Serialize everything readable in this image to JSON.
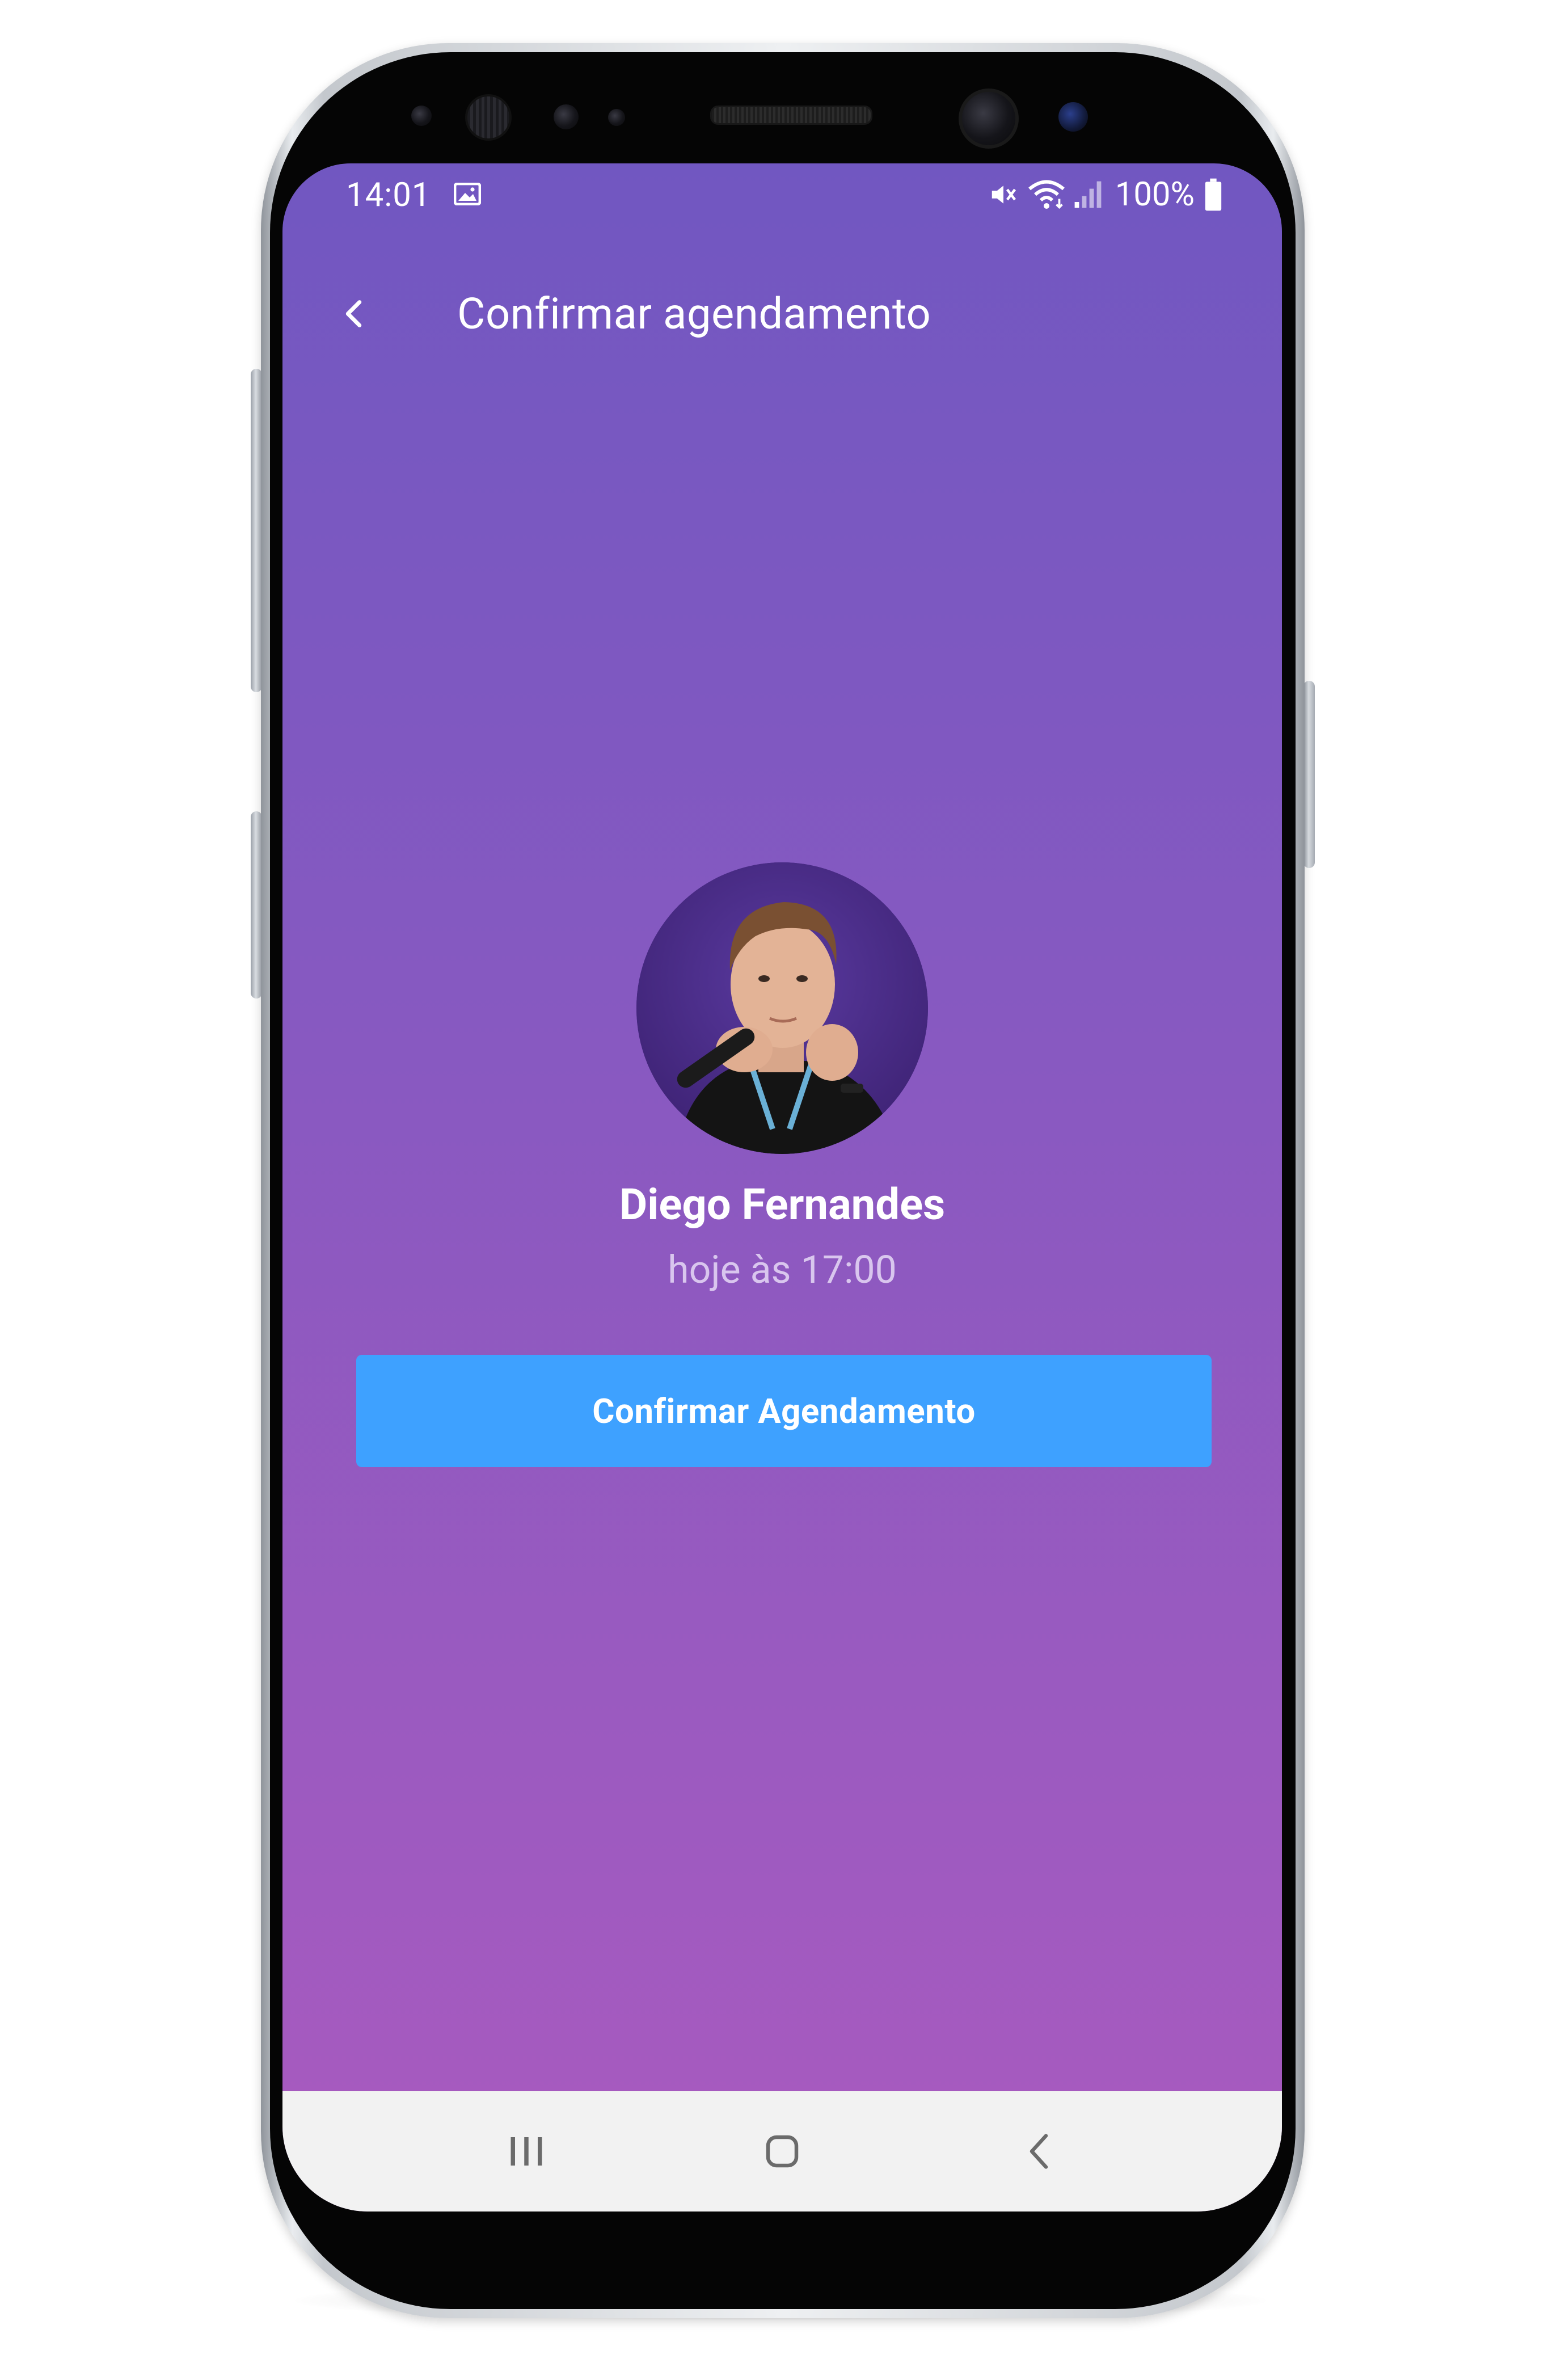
{
  "status_bar": {
    "time": "14:01",
    "battery_percent": "100%",
    "icons": [
      "image-icon",
      "mute-icon",
      "wifi-icon",
      "signal-icon",
      "battery-icon"
    ]
  },
  "header": {
    "back_icon": "chevron-left-icon",
    "title": "Confirmar agendamento"
  },
  "provider": {
    "name": "Diego Fernandes",
    "time": "hoje às 17:00"
  },
  "confirm_button": {
    "label": "Confirmar Agendamento"
  },
  "nav_bar": {
    "items": [
      "recent-apps-icon",
      "home-icon",
      "back-icon"
    ]
  },
  "colors": {
    "gradient_top": "#7157c1",
    "gradient_bottom": "#a95abf",
    "button": "#3ea1ff",
    "subtitle": "#d9c6ee",
    "nav_bar": "#f2f2f2"
  }
}
